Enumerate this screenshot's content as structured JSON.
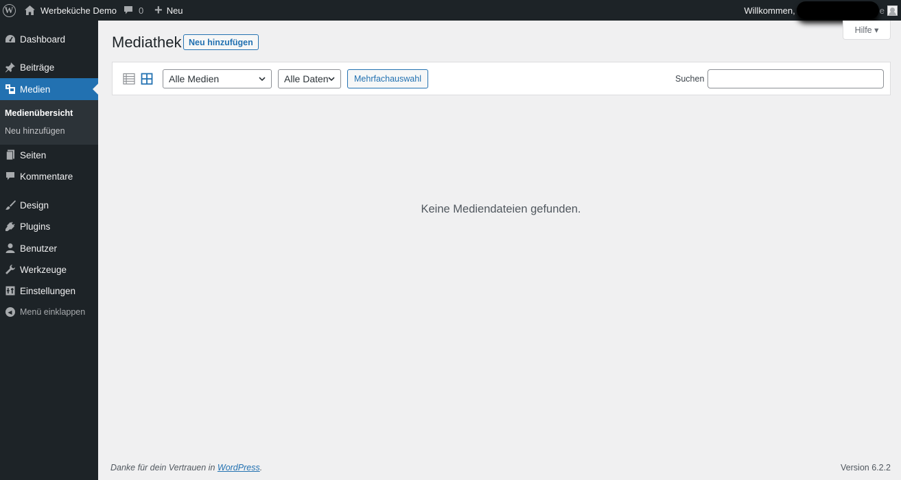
{
  "adminbar": {
    "site_name": "Werbeküche Demo",
    "comment_count": "0",
    "new_label": "Neu",
    "welcome": "Willkommen,",
    "welcome_tail": "e"
  },
  "sidebar": {
    "items": [
      {
        "label": "Dashboard",
        "icon": "dashboard-icon"
      },
      {
        "label": "Beiträge",
        "icon": "pin-icon"
      },
      {
        "label": "Medien",
        "icon": "media-icon"
      },
      {
        "label": "Seiten",
        "icon": "pages-icon"
      },
      {
        "label": "Kommentare",
        "icon": "comment-icon"
      },
      {
        "label": "Design",
        "icon": "brush-icon"
      },
      {
        "label": "Plugins",
        "icon": "plugin-icon"
      },
      {
        "label": "Benutzer",
        "icon": "user-icon"
      },
      {
        "label": "Werkzeuge",
        "icon": "wrench-icon"
      },
      {
        "label": "Einstellungen",
        "icon": "settings-icon"
      }
    ],
    "submenu": [
      "Medienübersicht",
      "Neu hinzufügen"
    ],
    "collapse_label": "Menü einklappen"
  },
  "main": {
    "help_label": "Hilfe ▾",
    "title": "Mediathek",
    "add_new_label": "Neu hinzufügen",
    "filter_media": "Alle Medien",
    "filter_dates": "Alle Daten",
    "bulk_select_label": "Mehrfachauswahl",
    "search_label": "Suchen",
    "search_value": "",
    "empty_message": "Keine Mediendateien gefunden."
  },
  "footer": {
    "thanks_prefix": "Danke für dein Vertrauen in ",
    "thanks_link": "WordPress",
    "thanks_suffix": ".",
    "version": "Version 6.2.2"
  },
  "colors": {
    "accent": "#2271b1",
    "adminbar_bg": "#1d2327",
    "body_bg": "#f0f0f1"
  }
}
